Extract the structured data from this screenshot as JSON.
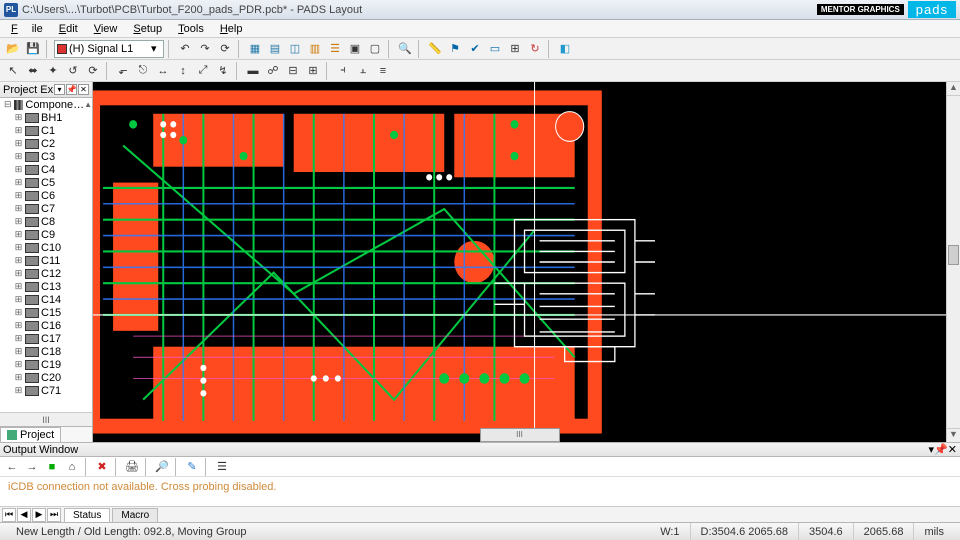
{
  "titlebar": {
    "app_icon_text": "PL",
    "title": "C:\\Users\\...\\Turbot\\PCB\\Turbot_F200_pads_PDR.pcb* - PADS Layout",
    "brand_small": "MENTOR\nGRAPHICS",
    "brand_large": "pads"
  },
  "menubar": {
    "items": [
      "File",
      "Edit",
      "View",
      "Setup",
      "Tools",
      "Help"
    ]
  },
  "toolbar1": {
    "layer_label": "(H) Signal L1"
  },
  "project_explorer": {
    "title": "Project Ex…",
    "tab_label": "Project",
    "scroll_label": "III",
    "root": "Compone…",
    "items": [
      "BH1",
      "C1",
      "C2",
      "C3",
      "C4",
      "C5",
      "C6",
      "C7",
      "C8",
      "C9",
      "C10",
      "C11",
      "C12",
      "C13",
      "C14",
      "C15",
      "C16",
      "C17",
      "C18",
      "C19",
      "C20",
      "C71"
    ]
  },
  "canvas": {
    "hscroll_label": "III"
  },
  "output": {
    "title": "Output Window",
    "message": "iCDB connection not available. Cross probing disabled.",
    "tabs": [
      "Status",
      "Macro"
    ]
  },
  "statusbar": {
    "left": "New Length / Old Length: 092.8, Moving Group",
    "w": "W:1",
    "d": "D:3504.6 2065.68",
    "g1": "3504.6",
    "g2": "2065.68",
    "units": "mils"
  }
}
